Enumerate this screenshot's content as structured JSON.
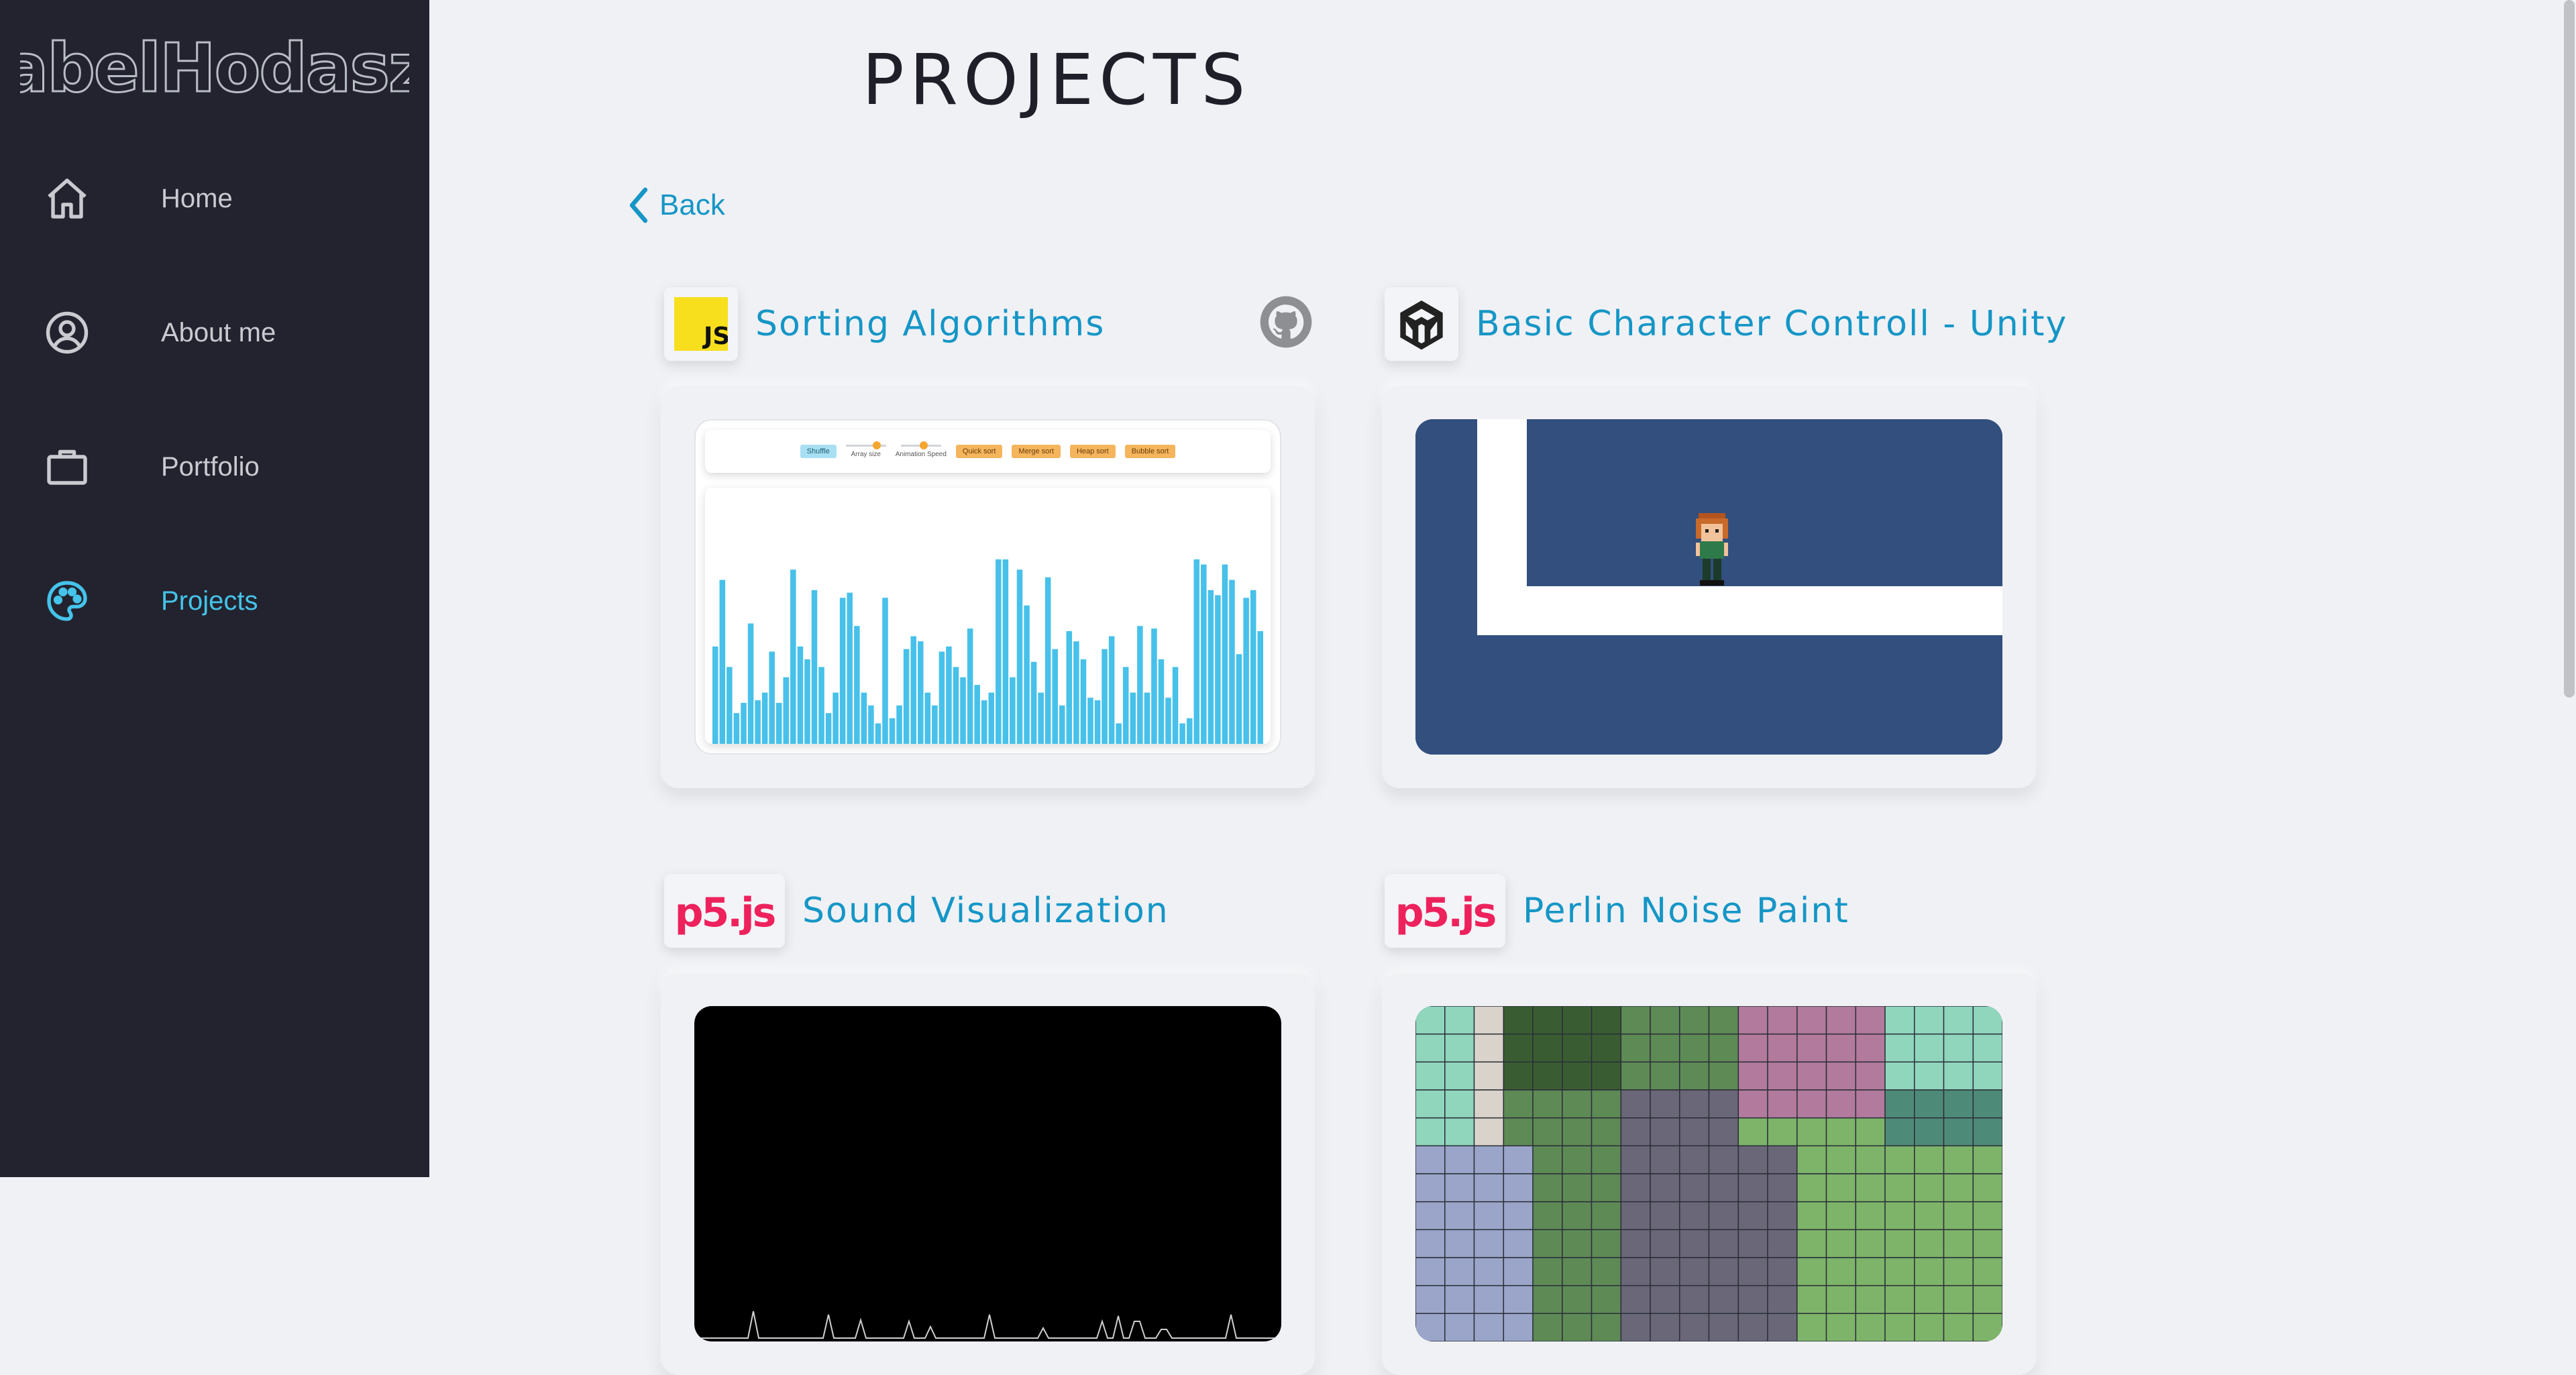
{
  "brand": {
    "logo_text": "abelHodasz"
  },
  "sidebar": {
    "items": [
      {
        "label": "Home",
        "icon": "home-icon",
        "active": false
      },
      {
        "label": "About me",
        "icon": "user-circle-icon",
        "active": false
      },
      {
        "label": "Portfolio",
        "icon": "briefcase-icon",
        "active": false
      },
      {
        "label": "Projects",
        "icon": "palette-icon",
        "active": true
      }
    ]
  },
  "colors": {
    "sidebar_bg": "#22232e",
    "page_bg": "#f0f1f5",
    "accent": "#45c3ea",
    "link": "#1596c6",
    "js_yellow": "#f7df1e",
    "p5_pink": "#ed225d",
    "unity_blue": "#324f7e"
  },
  "page": {
    "title": "PROJECTS",
    "back_label": "Back"
  },
  "projects": [
    {
      "title": "Sorting Algorithms",
      "tech": "JS",
      "tech_icon": "javascript-logo-icon",
      "github": true,
      "preview": {
        "type": "sorting-visualizer",
        "buttons": [
          "Shuffle",
          "Quick sort",
          "Merge sort",
          "Heap sort",
          "Bubble sort"
        ],
        "sliders": [
          "Array size",
          "Animation Speed"
        ]
      }
    },
    {
      "title": "Basic Character Controll - Unity",
      "tech": "Unity",
      "tech_icon": "unity-logo-icon",
      "github": false,
      "preview": {
        "type": "unity-scene"
      }
    },
    {
      "title": "Sound Visualization",
      "tech": "p5.js",
      "tech_icon": "p5js-logo-icon",
      "github": false,
      "preview": {
        "type": "waveform"
      }
    },
    {
      "title": "Perlin Noise Paint",
      "tech": "p5.js",
      "tech_icon": "p5js-logo-icon",
      "github": false,
      "preview": {
        "type": "pixel-grid"
      }
    }
  ]
}
